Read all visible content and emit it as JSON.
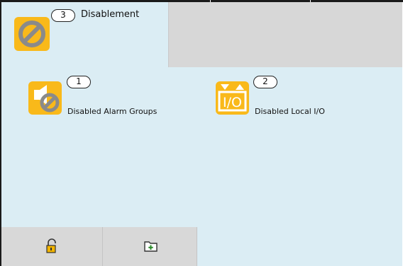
{
  "tabs": [
    {
      "label": "Disablement",
      "count": "3",
      "icon": "disable-icon"
    }
  ],
  "items": [
    {
      "label": "Disabled Alarm Groups",
      "count": "1",
      "icon": "disabled-alarm-groups-icon"
    },
    {
      "label": "Disabled Local I/O",
      "count": "2",
      "icon": "io-icon",
      "icon_text": "I/O"
    }
  ],
  "footer": {
    "unlock_icon": "unlock-icon",
    "folder_icon": "add-folder-icon"
  },
  "colors": {
    "panel": "#dbedf4",
    "inactive_tab": "#d7d7d7",
    "icon_bg": "#f9b91a",
    "icon_glyph": "#8a8a8a",
    "lock": "#e8a800"
  }
}
